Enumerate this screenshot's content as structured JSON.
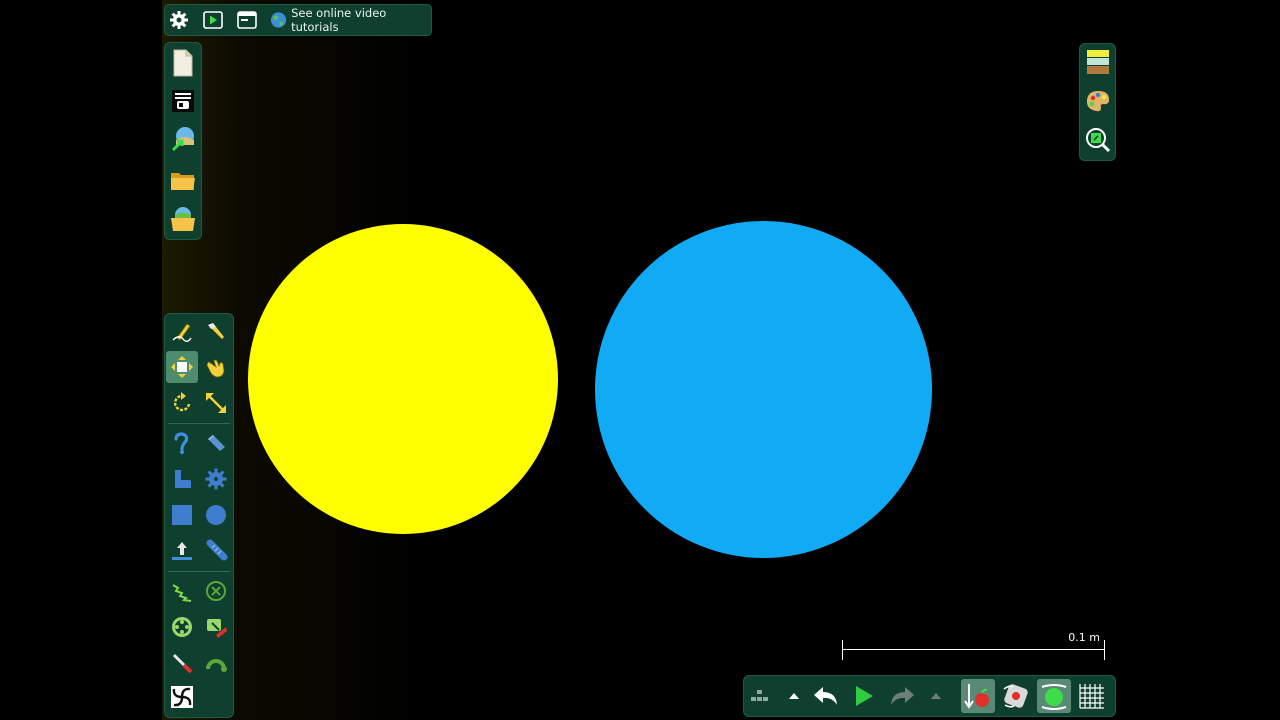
{
  "top_bar": {
    "settings_icon": "gear-icon",
    "play_icon": "play-window-icon",
    "window_icon": "window-icon",
    "tutorial_icon": "globe-icon",
    "tutorial_label": "See online video tutorials"
  },
  "file_panel": {
    "items": [
      "new-document-icon",
      "scene-menu-icon",
      "save-scene-icon",
      "open-folder-icon",
      "open-scene-icon"
    ]
  },
  "tools_panel": {
    "selected_tool": "move-icon",
    "items": [
      "sketch-icon",
      "knife-icon",
      "move-icon",
      "drag-hand-icon",
      "rotate-icon",
      "scale-icon",
      "rope-icon",
      "plane-icon",
      "polygon-icon",
      "gear-shape-icon",
      "box-icon",
      "circle-icon",
      "thruster-icon",
      "chain-icon",
      "spring-icon",
      "fixate-icon",
      "axle-icon",
      "tracer-icon",
      "laser-icon",
      "hinge-icon",
      "vortex-icon"
    ]
  },
  "right_panel": {
    "items": [
      "background-icon",
      "palette-icon",
      "zoom-to-fit-icon"
    ]
  },
  "scene": {
    "yellow_circle_color": "#ffff00",
    "blue_circle_color": "#10aaf5"
  },
  "scale_bar": {
    "label": "0.1 m"
  },
  "bottom_bar": {
    "items": [
      "nudge-icon",
      "undo-arrow-icon",
      "undo-icon",
      "play-icon",
      "redo-icon",
      "redo-arrow-icon",
      "gravity-icon",
      "air-friction-icon",
      "collision-icon",
      "grid-icon"
    ]
  },
  "colors": {
    "panel": "#0f3f2e",
    "selected": "#4f8c6e",
    "accent_green": "#2ecc40"
  }
}
